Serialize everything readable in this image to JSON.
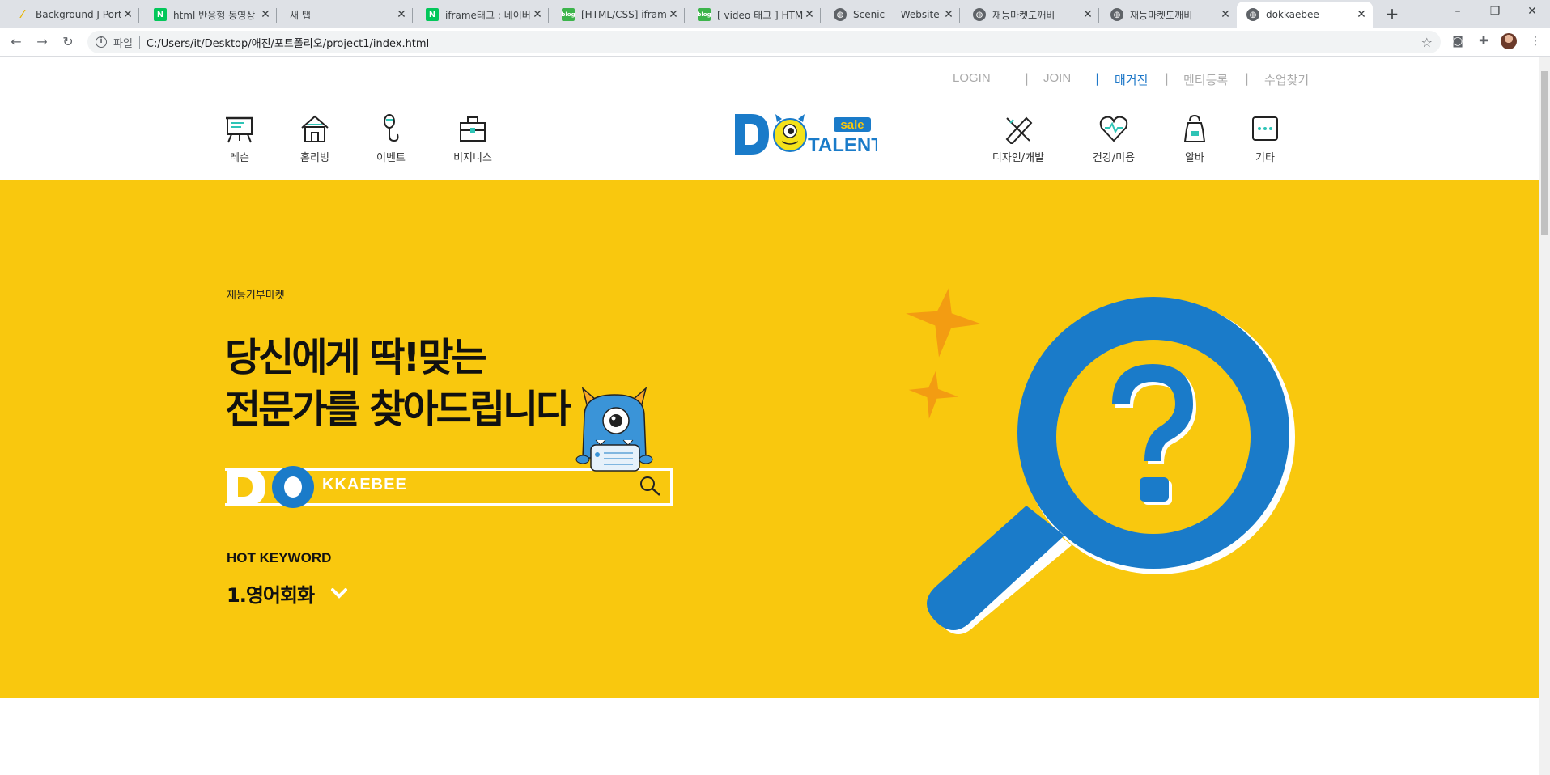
{
  "browser": {
    "tabs": [
      {
        "title": "Background J Portf",
        "favicon": "yellow-slash"
      },
      {
        "title": "html 반응형 동영상",
        "favicon": "N"
      },
      {
        "title": "새 탭",
        "favicon": ""
      },
      {
        "title": "iframe태그 : 네이버",
        "favicon": "N"
      },
      {
        "title": "[HTML/CSS] iframe",
        "favicon": "blog"
      },
      {
        "title": "[ video 태그 ] HTML",
        "favicon": "blog"
      },
      {
        "title": "Scenic — Website",
        "favicon": "globe"
      },
      {
        "title": "재능마켓도깨비",
        "favicon": "globe"
      },
      {
        "title": "재능마켓도깨비",
        "favicon": "globe"
      },
      {
        "title": "dokkaebee",
        "favicon": "globe"
      }
    ],
    "new_tab": "+",
    "window": {
      "minimize": "–",
      "restore": "❐",
      "close": "✕"
    },
    "address": {
      "scheme": "파일",
      "url": "C:/Users/it/Desktop/애진/포트폴리오/project1/index.html"
    }
  },
  "util_nav": [
    "LOGIN",
    "JOIN",
    "매거진",
    "멘티등록",
    "수업찾기"
  ],
  "util_nav_active": "매거진",
  "cat_left": [
    {
      "label": "레슨",
      "icon": "easel-icon"
    },
    {
      "label": "홈리빙",
      "icon": "house-icon"
    },
    {
      "label": "이벤트",
      "icon": "microphone-icon"
    },
    {
      "label": "비지니스",
      "icon": "briefcase-icon"
    }
  ],
  "cat_right": [
    {
      "label": "디자인/개발",
      "icon": "ruler-pencil-icon"
    },
    {
      "label": "건강/미용",
      "icon": "heart-pulse-icon"
    },
    {
      "label": "알바",
      "icon": "apron-icon"
    },
    {
      "label": "기타",
      "icon": "more-dots-icon"
    }
  ],
  "logo": {
    "letters": "DO",
    "word": "TALENT",
    "tag": "sale"
  },
  "hero": {
    "eyebrow": "재능기부마켓",
    "headline_line1": "당신에게 딱!맞는",
    "headline_line2": "전문가를 찾아드립니다",
    "search_prefix": "DO",
    "search_text": "KKAEBEE",
    "hot_keyword_title": "HOT KEYWORD",
    "hot_keyword_item": "1.영어회화"
  },
  "colors": {
    "hero_bg": "#f9c80e",
    "brand_blue": "#1a7bc9",
    "spark": "#f39c12",
    "accent_link": "#1f78c8"
  }
}
